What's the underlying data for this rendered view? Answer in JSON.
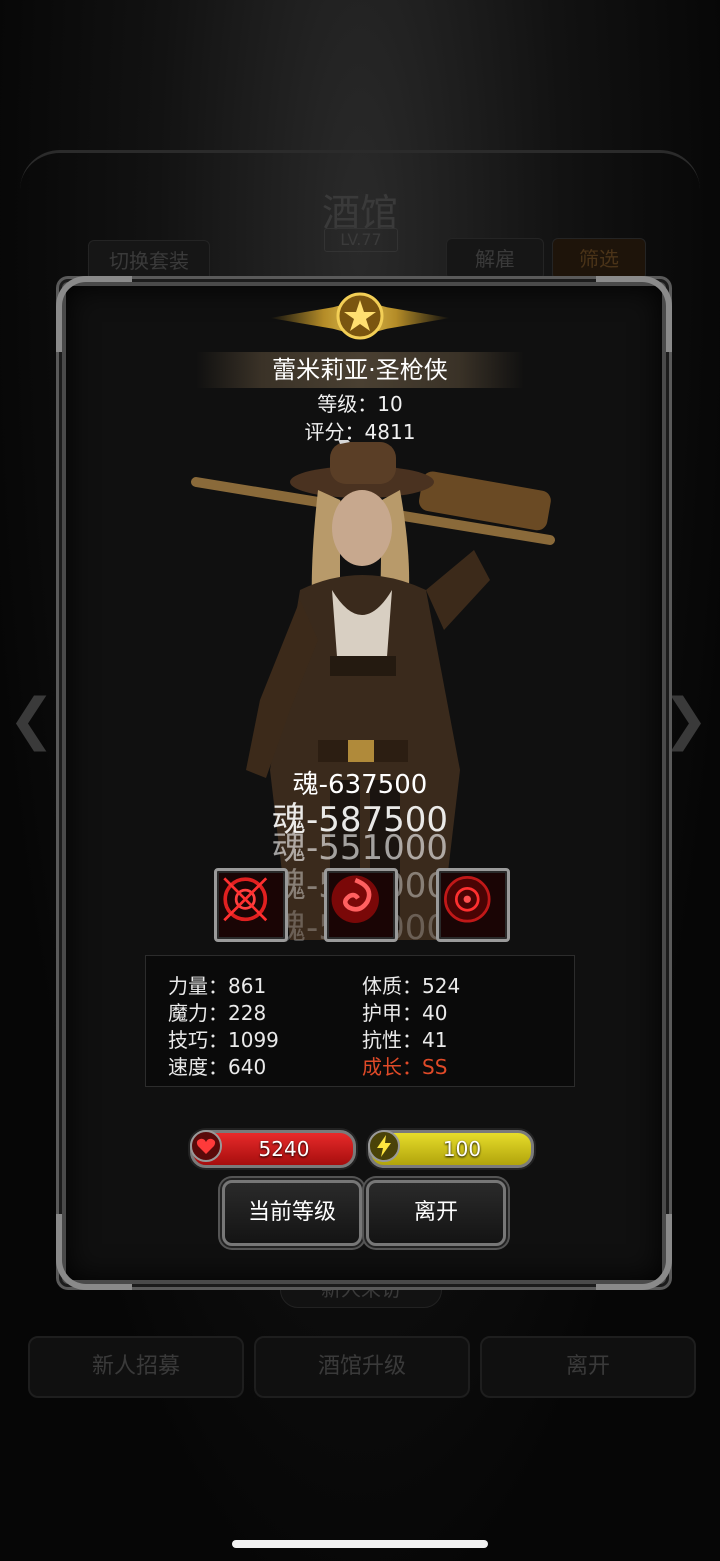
{
  "background": {
    "title": "酒馆",
    "level": "LV.77",
    "switch_outfit": "切换套装",
    "dismiss": "解雇",
    "filter": "筛选",
    "new_visitor": "新人来访",
    "recruit": "新人招募",
    "upgrade": "酒馆升级",
    "leave": "离开"
  },
  "hero": {
    "name": "蕾米莉亚·圣枪侠",
    "level_text": "等级：10",
    "score_text": "评分：4811"
  },
  "soul_values": [
    "魂-637500",
    "魂-587500",
    "魂-551000",
    "魂-531000",
    "魂-503000"
  ],
  "skills": [
    {
      "icon": "crosshair-ring-icon"
    },
    {
      "icon": "red-swirl-icon"
    },
    {
      "icon": "red-target-icon"
    }
  ],
  "stats": {
    "strength": "力量：861",
    "constitution": "体质：524",
    "magic": "魔力：228",
    "armor": "护甲：40",
    "skill": "技巧：1099",
    "resistance": "抗性：41",
    "speed": "速度：640",
    "growth": "成长：SS"
  },
  "bars": {
    "hp": "5240",
    "energy": "100"
  },
  "buttons": {
    "current_level": "当前等级",
    "leave": "离开"
  },
  "colors": {
    "growth": "#e04a28",
    "hp": "#d41b1b",
    "energy": "#d4c81b",
    "gold": "#e0b040"
  }
}
